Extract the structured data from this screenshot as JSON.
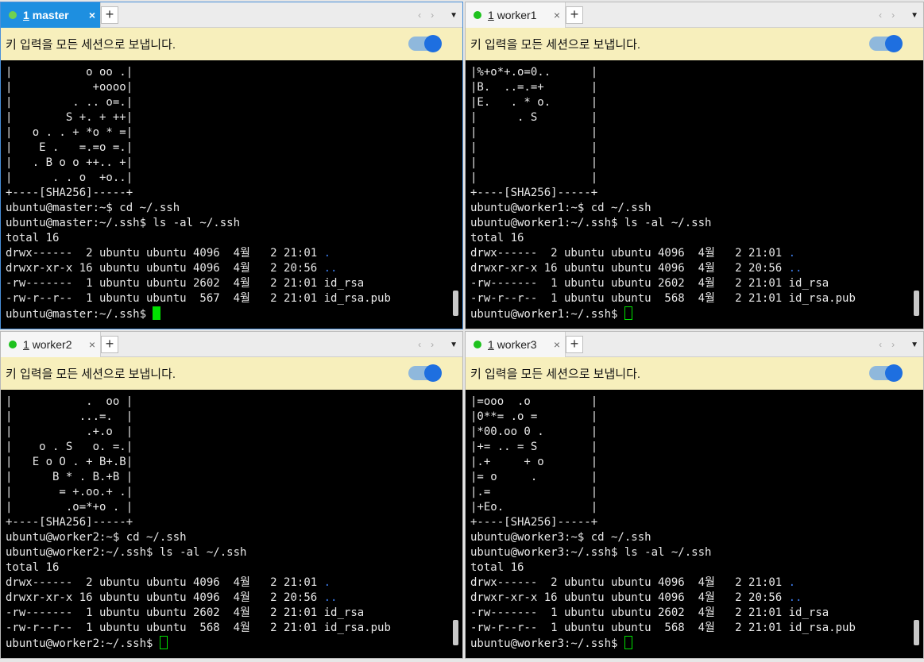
{
  "broadcast_text": "키 입력을 모든 세션으로 보냅니다.",
  "tab_close_symbol": "×",
  "tab_add_symbol": "+",
  "nav_left_symbol": "‹",
  "nav_right_symbol": "›",
  "tab_dropdown_symbol": "▼",
  "colors": {
    "active_tab": "#1e8fe0",
    "broadcast_bar": "#f7efbc",
    "status_dot": "#1ec21e",
    "cursor": "#00e000",
    "dir_listing_blue": "#3b7bea"
  },
  "sessions": [
    {
      "tab_number": "1",
      "tab_name": "master",
      "active": true,
      "lines": [
        "|           o oo .|",
        "|            +oooo|",
        "|         . .. o=.|",
        "|        S +. + ++|",
        "|   o . . + *o * =|",
        "|    E .   =.=o =.|",
        "|   . B o o ++.. +|",
        "|      . . o  +o..|",
        "+----[SHA256]-----+",
        "ubuntu@master:~$ cd ~/.ssh",
        "ubuntu@master:~/.ssh$ ls -al ~/.ssh",
        "total 16",
        "drwx------  2 ubuntu ubuntu 4096  4월   2 21:01 ",
        "drwxr-xr-x 16 ubuntu ubuntu 4096  4월   2 20:56 ",
        "-rw-------  1 ubuntu ubuntu 2602  4월   2 21:01 id_rsa",
        "-rw-r--r--  1 ubuntu ubuntu  567  4월   2 21:01 id_rsa.pub",
        "ubuntu@master:~/.ssh$ "
      ]
    },
    {
      "tab_number": "1",
      "tab_name": "worker1",
      "active": false,
      "lines": [
        "|%+o*+.o=0..      |",
        "|B.  ..=.=+       |",
        "|E.   . * o.      |",
        "|      . S        |",
        "|                 |",
        "|                 |",
        "|                 |",
        "|                 |",
        "+----[SHA256]-----+",
        "ubuntu@worker1:~$ cd ~/.ssh",
        "ubuntu@worker1:~/.ssh$ ls -al ~/.ssh",
        "total 16",
        "drwx------  2 ubuntu ubuntu 4096  4월   2 21:01 ",
        "drwxr-xr-x 16 ubuntu ubuntu 4096  4월   2 20:56 ",
        "-rw-------  1 ubuntu ubuntu 2602  4월   2 21:01 id_rsa",
        "-rw-r--r--  1 ubuntu ubuntu  568  4월   2 21:01 id_rsa.pub",
        "ubuntu@worker1:~/.ssh$ "
      ]
    },
    {
      "tab_number": "1",
      "tab_name": "worker2",
      "active": false,
      "lines": [
        "|           .  oo |",
        "|          ...=.  |",
        "|           .+.o  |",
        "|    o . S   o. =.|",
        "|   E o O . + B+.B|",
        "|      B * . B.+B |",
        "|       = +.oo.+ .|",
        "|        .o=*+o . |",
        "+----[SHA256]-----+",
        "ubuntu@worker2:~$ cd ~/.ssh",
        "ubuntu@worker2:~/.ssh$ ls -al ~/.ssh",
        "total 16",
        "drwx------  2 ubuntu ubuntu 4096  4월   2 21:01 ",
        "drwxr-xr-x 16 ubuntu ubuntu 4096  4월   2 20:56 ",
        "-rw-------  1 ubuntu ubuntu 2602  4월   2 21:01 id_rsa",
        "-rw-r--r--  1 ubuntu ubuntu  568  4월   2 21:01 id_rsa.pub",
        "ubuntu@worker2:~/.ssh$ "
      ]
    },
    {
      "tab_number": "1",
      "tab_name": "worker3",
      "active": false,
      "lines": [
        "|=ooo  .o         |",
        "|0**= .o =        |",
        "|*00.oo 0 .       |",
        "|+= .. = S        |",
        "|.+     + o       |",
        "|= o     .        |",
        "|.=               |",
        "|+Eo.             |",
        "+----[SHA256]-----+",
        "ubuntu@worker3:~$ cd ~/.ssh",
        "ubuntu@worker3:~/.ssh$ ls -al ~/.ssh",
        "total 16",
        "drwx------  2 ubuntu ubuntu 4096  4월   2 21:01 ",
        "drwxr-xr-x 16 ubuntu ubuntu 4096  4월   2 20:56 ",
        "-rw-------  1 ubuntu ubuntu 2602  4월   2 21:01 id_rsa",
        "-rw-r--r--  1 ubuntu ubuntu  568  4월   2 21:01 id_rsa.pub",
        "ubuntu@worker3:~/.ssh$ "
      ]
    }
  ],
  "dir_names": [
    ".",
    ".."
  ]
}
